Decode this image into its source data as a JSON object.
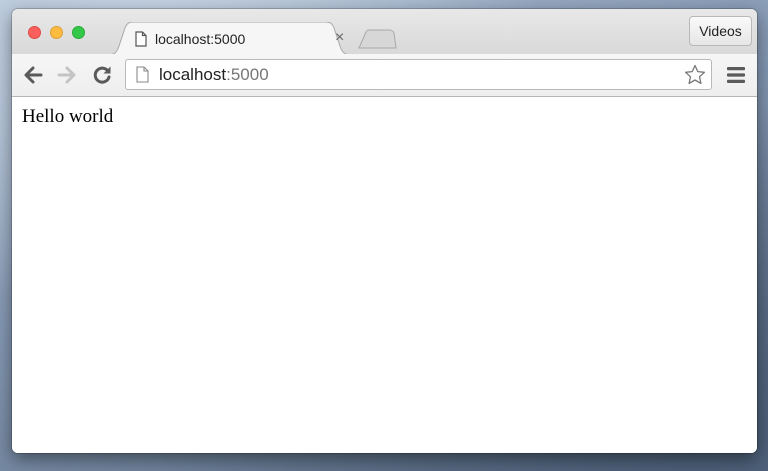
{
  "window": {
    "tab": {
      "title": "localhost:5000",
      "page_icon": "document-icon",
      "close_icon": "close-icon",
      "close_glyph": "×"
    },
    "new_tab_icon": "new-tab-icon",
    "extension_button_label": "Videos"
  },
  "toolbar": {
    "back_icon": "arrow-left-icon",
    "forward_icon": "arrow-right-icon",
    "reload_icon": "reload-icon",
    "address": {
      "host": "localhost",
      "port": ":5000",
      "page_icon": "document-icon"
    },
    "bookmark_icon": "star-icon",
    "menu_icon": "hamburger-icon"
  },
  "page": {
    "text": "Hello world"
  },
  "colors": {
    "close_red": "#fc605c",
    "minimize_yellow": "#fdbc40",
    "zoom_green": "#34c84a"
  }
}
